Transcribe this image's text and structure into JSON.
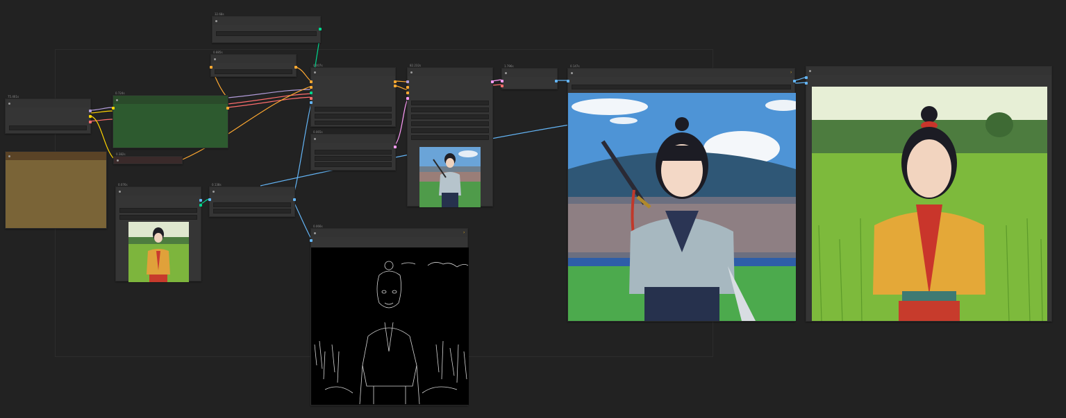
{
  "canvas": {
    "background": "#222222",
    "link_colors": {
      "image": "#64b5f6",
      "model": "#b39ddb",
      "clip": "#ffd500",
      "vae": "#ff6e6e",
      "conditioning": "#ffa931",
      "latent": "#ff9cf9",
      "control": "#00d78d"
    }
  },
  "nodes": {
    "n_top": {
      "title": "32.68s"
    },
    "n_upper": {
      "title": "0.885s"
    },
    "n_loader": {
      "title": "75.461s"
    },
    "n_green": {
      "title": "0.724s"
    },
    "n_dark": {
      "title": "0.382s"
    },
    "n_brown": {
      "title": ""
    },
    "n_cond": {
      "title": "0.007s"
    },
    "n_sampler": {
      "title": "82.232s"
    },
    "n_latent": {
      "title": "0.065s"
    },
    "n_decode": {
      "title": "1.796s"
    },
    "n_load_image": {
      "title": "0.076s"
    },
    "n_resize": {
      "title": "0.138s"
    },
    "n_canny": {
      "title": "0.066s"
    },
    "n_preview": {
      "title": "0.147s"
    },
    "n_save": {
      "title": ""
    }
  },
  "icons": [
    "collapse-dot-icon",
    "badge-icon"
  ]
}
